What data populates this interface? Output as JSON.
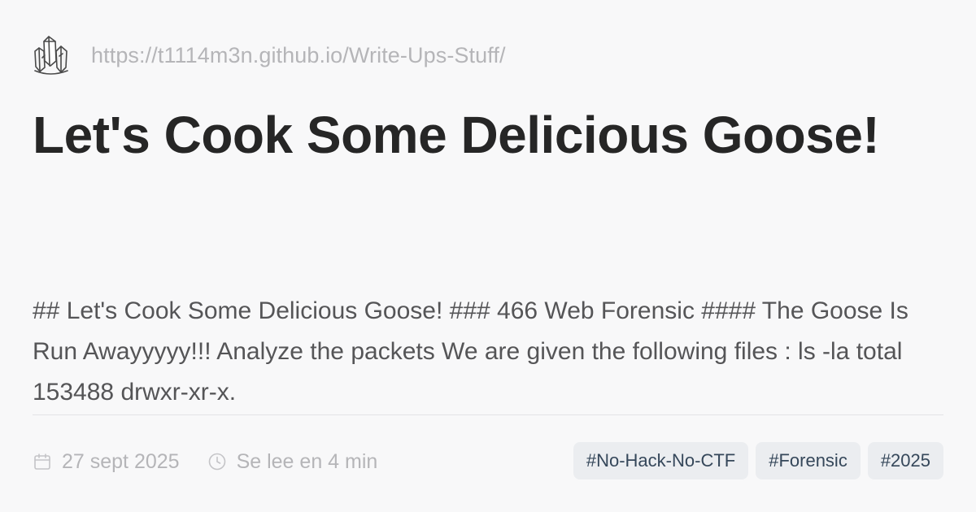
{
  "site": {
    "logo_icon": "crystal-cluster-icon",
    "url": "https://t1114m3n.github.io/Write-Ups-Stuff/"
  },
  "post": {
    "title": "Let's Cook Some Delicious Goose!",
    "excerpt": "## Let's Cook Some Delicious Goose! ### 466 Web Forensic #### The Goose Is Run Awayyyyy!!! Analyze the packets We are given the following files : ls -la total 153488 drwxr-xr-x.",
    "date": "27 sept 2025",
    "date_icon": "calendar-icon",
    "reading_time": "Se lee en 4 min",
    "reading_time_icon": "clock-icon",
    "tags": [
      "#No-Hack-No-CTF",
      "#Forensic",
      "#2025"
    ]
  },
  "colors": {
    "background": "#f8f8f9",
    "title": "#262626",
    "excerpt": "#555557",
    "muted": "#b5b5b8",
    "tag_bg": "#ebedf0",
    "tag_text": "#35475a"
  }
}
